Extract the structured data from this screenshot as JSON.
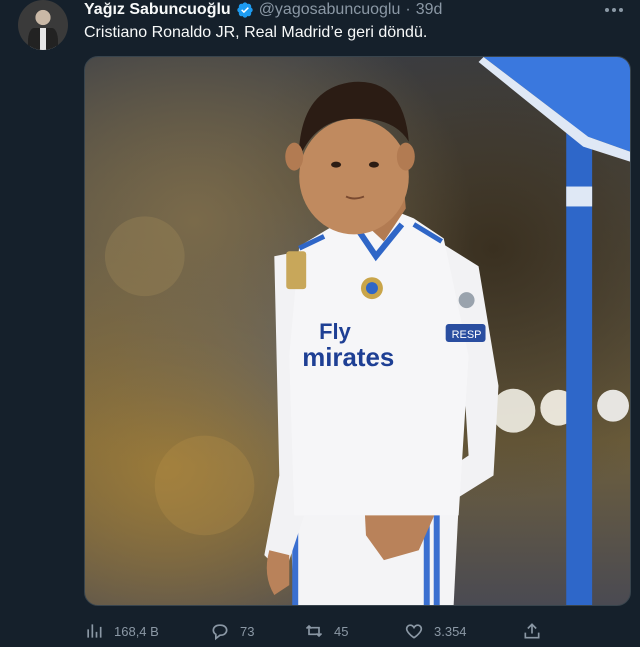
{
  "tweet": {
    "author_name": "Yağız Sabuncuoğlu",
    "handle": "@yagosabuncuoglu",
    "separator": "·",
    "time": "39d",
    "text": "Cristiano Ronaldo JR, Real Madrid’e geri döndü."
  },
  "media": {
    "shirt_sponsor_line1": "Fly",
    "shirt_sponsor_line2": "mirates",
    "sleeve_patch": "RESP"
  },
  "actions": {
    "views": "168,4 B",
    "replies": "73",
    "retweets": "45",
    "likes": "3.354"
  },
  "colors": {
    "background": "#15202b",
    "verified": "#1d9bf0",
    "muted_text": "#8b98a5"
  }
}
